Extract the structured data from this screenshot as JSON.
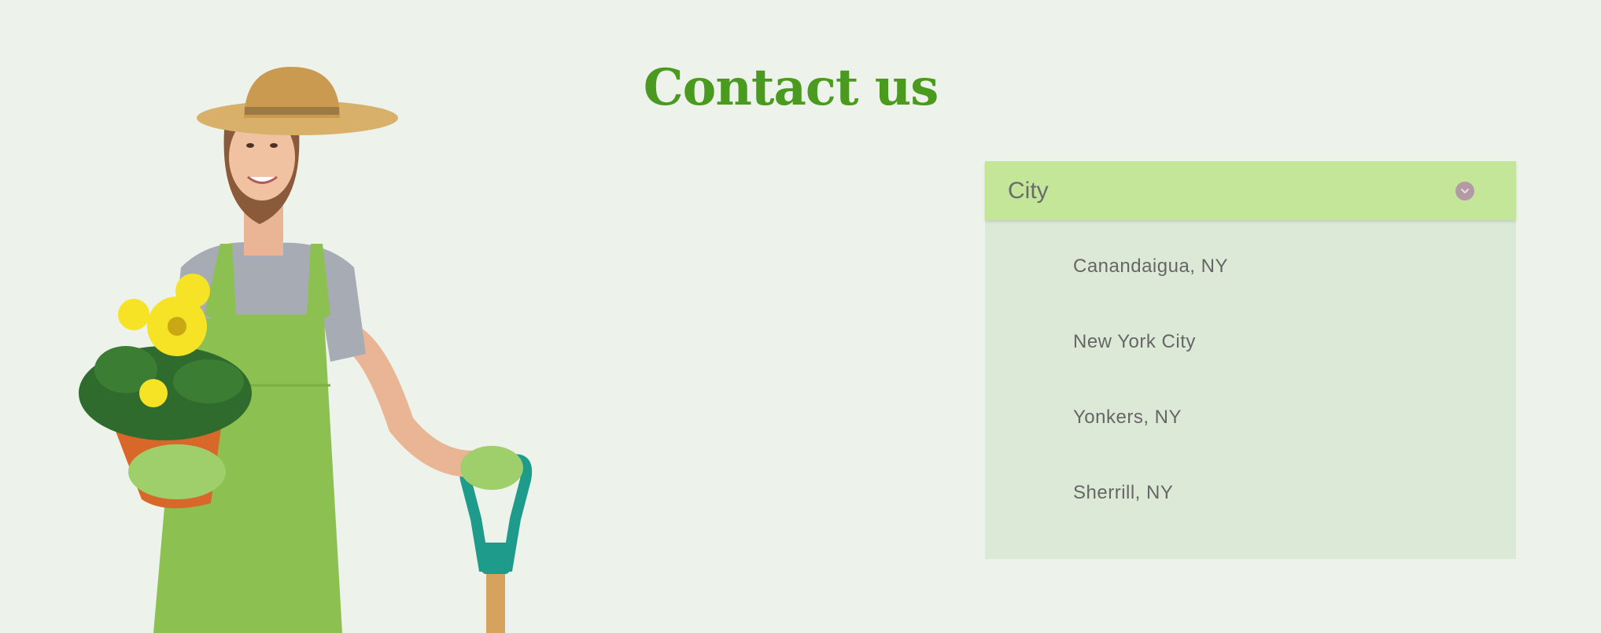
{
  "heading": "Contact us",
  "illustration": {
    "icon": "gardener-illustration",
    "colors": {
      "apron": "#8cc152",
      "shirt": "#a7abb4",
      "hat": "#d8b06a",
      "flowers": "#f7e325",
      "pot": "#d7682a",
      "shovel_handle": "#1f9b8c"
    }
  },
  "dropdown": {
    "label": "City",
    "icon": "chevron-down-icon",
    "options": [
      "Canandaigua, NY",
      "New York City",
      "Yonkers, NY",
      "Sherrill, NY"
    ]
  },
  "colors": {
    "background": "#edf2eb",
    "heading": "#4a9a1f",
    "dropdown_header": "#c3e698",
    "dropdown_panel": "#dde9d7"
  }
}
